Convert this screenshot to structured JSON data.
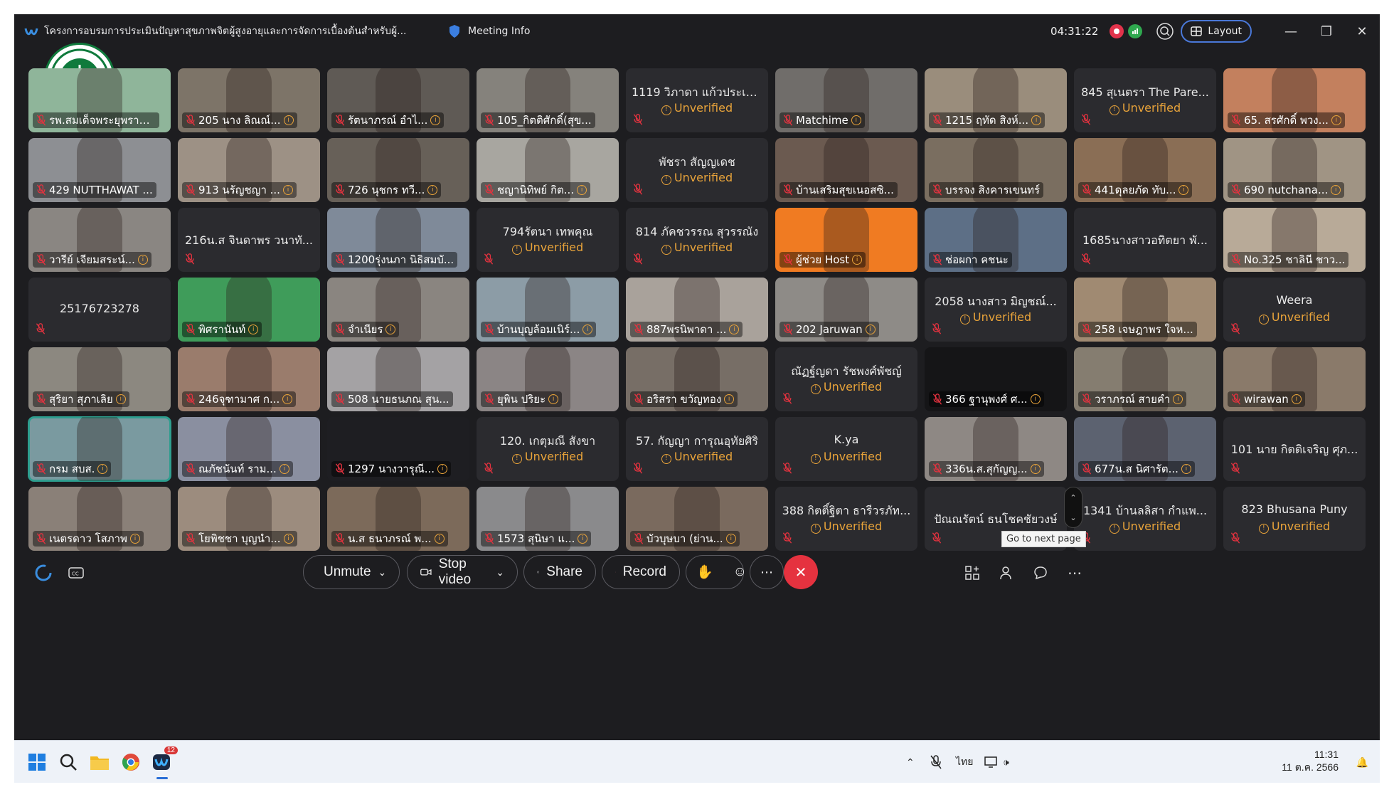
{
  "titlebar": {
    "title": "โครงการอบรมการประเมินปัญหาสุขภาพจิตผู้สูงอายุและการจัดการเบื้องต้นสำหรับผู้...",
    "meeting_info": "Meeting Info",
    "timer": "04:31:22",
    "layout_label": "Layout"
  },
  "tiles": [
    {
      "label": "รพ.สมเด็จพระยุพราช 01",
      "kind": "video",
      "tone": "#8fb59a",
      "info": false
    },
    {
      "label": "205 นาง ลิณณ์...",
      "kind": "video",
      "tone": "#7d7468",
      "info": true
    },
    {
      "label": "รัตนาภรณ์ อำไ...",
      "kind": "video",
      "tone": "#5f5a55",
      "info": true
    },
    {
      "label": "105_กิตติศักดิ์(สุข...",
      "kind": "video",
      "tone": "#85827c",
      "info": false
    },
    {
      "center": "1119 วิภาดา แก้วประเส...",
      "unverified": "Unverified",
      "kind": "text"
    },
    {
      "label": "Matchime",
      "kind": "video",
      "tone": "#706d6a",
      "info": true
    },
    {
      "label": "1215 ฤทัด สิงห์...",
      "kind": "video",
      "tone": "#9a8d7c",
      "info": true
    },
    {
      "center": "845 สุเนตรา The Pare...",
      "unverified": "Unverified",
      "kind": "text"
    },
    {
      "label": "65. สรศักดิ์ พวง...",
      "kind": "video",
      "tone": "#c3805e",
      "info": true
    },
    {
      "label": "429 NUTTHAWAT ...",
      "kind": "video",
      "tone": "#8d8f93",
      "info": false
    },
    {
      "label": "913 นรัญชญา ...",
      "kind": "video",
      "tone": "#9d9185",
      "info": true
    },
    {
      "label": "726 นุชกร ทวี...",
      "kind": "video",
      "tone": "#676058",
      "info": true
    },
    {
      "label": "ชญานิทิพย์ กิต...",
      "kind": "video",
      "tone": "#a8a6a0",
      "info": true
    },
    {
      "center": "พัชรา สัญญเดช",
      "unverified": "Unverified",
      "kind": "text"
    },
    {
      "label": "บ้านเสริมสุขเนอสซิ...",
      "kind": "video",
      "tone": "#6b5a50",
      "info": false
    },
    {
      "label": "บรรจง สิงคารเขนทร์",
      "kind": "video",
      "tone": "#7a6e60",
      "info": false
    },
    {
      "label": "441ดุลยภัด ทับ...",
      "kind": "video",
      "tone": "#8a6e55",
      "info": true
    },
    {
      "label": "690 nutchana...",
      "kind": "video",
      "tone": "#a09484",
      "info": true
    },
    {
      "label": "วารีย์ เจียมสระน์...",
      "kind": "video",
      "tone": "#8a8682",
      "info": true
    },
    {
      "center": "216น.ส จินดาพร วนาทั...",
      "kind": "text"
    },
    {
      "label": "1200รุ่งนภา นิธิสมบั...",
      "kind": "video",
      "tone": "#7f8a99",
      "info": false
    },
    {
      "center": "794รัตนา เทพคุณ",
      "unverified": "Unverified",
      "kind": "text"
    },
    {
      "center": "814 ภัคชวรรณ สุวรรณัง",
      "unverified": "Unverified",
      "kind": "text"
    },
    {
      "label": "ผู้ช่วย Host",
      "kind": "host",
      "tone": "#f07b22",
      "info": true
    },
    {
      "label": "ช่อผกา คชนะ",
      "kind": "video",
      "tone": "#5d6f86",
      "info": false
    },
    {
      "center": "1685นางสาวอทิตยา พั...",
      "kind": "text"
    },
    {
      "label": "No.325 ชาลินี ชาว...",
      "kind": "video",
      "tone": "#b8aa98",
      "info": false
    },
    {
      "center": "25176723278",
      "kind": "text"
    },
    {
      "label": "พิศรานันท์",
      "kind": "video",
      "tone": "#3f9c5a",
      "info": true
    },
    {
      "label": "จำเนียร",
      "kind": "video",
      "tone": "#8a8580",
      "info": true
    },
    {
      "label": "บ้านบุญล้อมเนิร์...",
      "kind": "video",
      "tone": "#8c9ca6",
      "info": true
    },
    {
      "label": "887พรนิพาดา ...",
      "kind": "video",
      "tone": "#a9a29b",
      "info": true
    },
    {
      "label": "202 Jaruwan",
      "kind": "video",
      "tone": "#8e8b87",
      "info": true
    },
    {
      "center": "2058 นางสาว มิญชณ์...",
      "unverified": "Unverified",
      "kind": "text"
    },
    {
      "label": "258 เจษฎาพร ใจห...",
      "kind": "video",
      "tone": "#a08a72",
      "info": false
    },
    {
      "center": "Weera",
      "unverified": "Unverified",
      "kind": "text"
    },
    {
      "label": "สุริยา สุภาเลิย",
      "kind": "video",
      "tone": "#8c8880",
      "info": true
    },
    {
      "label": "246จุฑามาศ ก...",
      "kind": "video",
      "tone": "#9a7c6c",
      "info": true
    },
    {
      "label": "508 นายธนภณ สุน...",
      "kind": "video",
      "tone": "#a4a2a4",
      "info": false
    },
    {
      "label": "ยุพิน ปริยะ",
      "kind": "video",
      "tone": "#8b8585",
      "info": true
    },
    {
      "label": "อริสรา ขวัญทอง",
      "kind": "video",
      "tone": "#776e66",
      "info": true
    },
    {
      "center": "ณัฏฐ์ญดา รัชพงศ์พัชญ์",
      "unverified": "Unverified",
      "kind": "text"
    },
    {
      "label": "366 ฐานุพงศ์ ศ...",
      "kind": "dark",
      "tone": "#151517",
      "info": true
    },
    {
      "label": "วราภรณ์ สายคำ",
      "kind": "video",
      "tone": "#857d70",
      "info": true
    },
    {
      "label": "wirawan",
      "kind": "video",
      "tone": "#8a7a6a",
      "info": true
    },
    {
      "label": "กรม สบส.",
      "kind": "video",
      "tone": "#7a9aa0",
      "info": true,
      "active": true
    },
    {
      "label": "ณภัชนันท์ ราม...",
      "kind": "video",
      "tone": "#8a8fa0",
      "info": true
    },
    {
      "label": "1297 นางวารุณี...",
      "kind": "dark",
      "tone": "#1e1e22",
      "info": true
    },
    {
      "center": "120. เกตุมณี สังขา",
      "unverified": "Unverified",
      "kind": "text"
    },
    {
      "center": "57. กัญญา การุณอุทัยศิริ",
      "unverified": "Unverified",
      "kind": "text"
    },
    {
      "center": "K.ya",
      "unverified": "Unverified",
      "kind": "text"
    },
    {
      "label": "336น.ส.สุกัญญ...",
      "kind": "video",
      "tone": "#8e8884",
      "info": true
    },
    {
      "label": "677น.ส นิศารัต...",
      "kind": "video",
      "tone": "#5c6270",
      "info": true
    },
    {
      "center": "101 นาย กิตติเจริญ ศุภ...",
      "kind": "text"
    },
    {
      "label": "เนตรดาว โสภาพ",
      "kind": "video",
      "tone": "#8a8078",
      "info": true
    },
    {
      "label": "โยพิชชา บุญนำ...",
      "kind": "video",
      "tone": "#9c8c7e",
      "info": true
    },
    {
      "label": "น.ส ธนาภรณ์ พ...",
      "kind": "video",
      "tone": "#7c6a5a",
      "info": true
    },
    {
      "label": "1573 สุนิษา แ...",
      "kind": "video",
      "tone": "#8a8a8c",
      "info": true
    },
    {
      "label": "บัวบุษบา (ย่าน...",
      "kind": "video",
      "tone": "#7a6a5e",
      "info": true
    },
    {
      "center": "388 กิตติ์ฐิตา ธารีวรภัท...",
      "unverified": "Unverified",
      "kind": "text"
    },
    {
      "center": "ปัณณรัตน์ ธนโชคชัยวงษ์",
      "kind": "text"
    },
    {
      "center": "1341 บ้านลลิสา กำแพ...",
      "unverified": "Unverified",
      "kind": "text"
    },
    {
      "center": "823 Bhusana Puny",
      "unverified": "Unverified",
      "kind": "text"
    }
  ],
  "tooltip": "Go to next page",
  "controls": {
    "unmute": "Unmute",
    "stop_video": "Stop video",
    "share": "Share",
    "record": "Record"
  },
  "taskbar": {
    "webex_badge": "12",
    "lang": "ไทย",
    "time": "11:31",
    "date": "11 ต.ค. 2566"
  }
}
